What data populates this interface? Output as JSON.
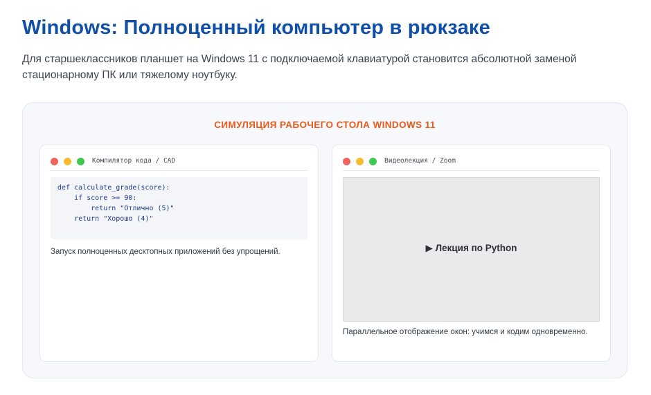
{
  "header": {
    "title": "Windows: Полноценный компьютер в рюкзаке",
    "lead": "Для старшеклассников планшет на Windows 11 с подключаемой клавиатурой становится абсолютной заменой стационарному ПК или тяжелому ноутбуку."
  },
  "simulation": {
    "heading": "СИМУЛЯЦИЯ РАБОЧЕГО СТОЛА WINDOWS 11",
    "windows": [
      {
        "title": "Компилятор кода / CAD",
        "code_lines": [
          "def calculate_grade(score):",
          "    if score >= 90:",
          "        return \"Отлично (5)\"",
          "    return \"Хорошо (4)\""
        ],
        "caption": "Запуск полноценных десктопных приложений без упрощений."
      },
      {
        "title": "Видеолекция / Zoom",
        "video_label": "▶ Лекция по Python",
        "caption": "Параллельное отображение окон: учимся и кодим одновременно."
      }
    ]
  },
  "colors": {
    "title": "#0f4fa8",
    "heading_accent": "#ea5a1b",
    "window_dot_red": "#f0635c",
    "window_dot_yellow": "#f5bd2f",
    "window_dot_green": "#3fc850"
  }
}
